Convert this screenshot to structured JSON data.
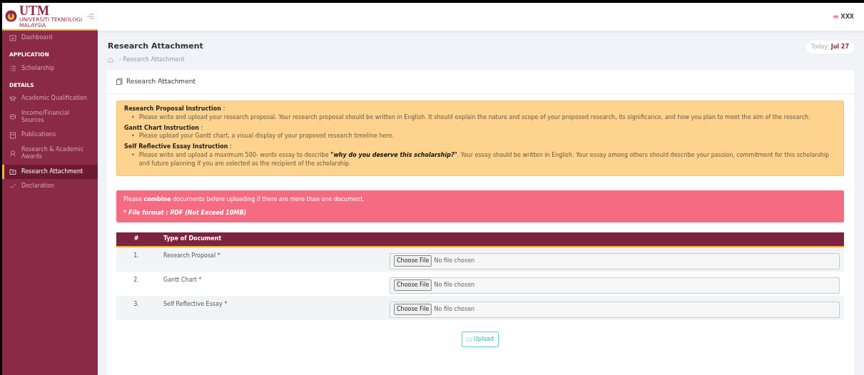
{
  "header": {
    "logo_text": "UTM",
    "logo_subtext": "UNIVERSITI TEKNOLOGI MALAYSIA",
    "user": "XXX"
  },
  "sidebar": {
    "items": [
      {
        "kind": "item",
        "label": "Dashboard",
        "selected": false
      },
      {
        "kind": "section",
        "label": "APPLICATION"
      },
      {
        "kind": "item",
        "label": "Scholarship",
        "selected": false
      },
      {
        "kind": "section",
        "label": "DETAILS"
      },
      {
        "kind": "item",
        "label": "Academic Qualification",
        "selected": false
      },
      {
        "kind": "item",
        "label": "Income/Financial Sources",
        "selected": false
      },
      {
        "kind": "item",
        "label": "Publications",
        "selected": false
      },
      {
        "kind": "item",
        "label": "Research & Academic Awards",
        "selected": false
      },
      {
        "kind": "item",
        "label": "Research Attachment",
        "selected": true
      },
      {
        "kind": "item",
        "label": "Declaration",
        "selected": false
      }
    ]
  },
  "page": {
    "title": "Research Attachment",
    "breadcrumb": "- Research Attachment",
    "today_label": "Today:",
    "today_date": "Jul 27"
  },
  "card": {
    "title": "Research Attachment",
    "instructions": [
      {
        "heading": "Research Proposal Instruction",
        "colon": ":",
        "bullets": [
          {
            "marker": "•",
            "text": "Please write and upload your research proposal. Your research proposal should be written in English. It should explain the nature and scope of your proposed research, its significance, and how you plan to meet the aim of the research."
          }
        ]
      },
      {
        "heading": "Gantt Chart Instruction",
        "colon": ":",
        "bullets": [
          {
            "marker": "•",
            "text": "Please upload your Gantt chart, a visual display of your proposed research timeline here."
          }
        ]
      },
      {
        "heading": "Self Reflective Essay Instruction",
        "colon": ":",
        "bullets": [
          {
            "marker": "•",
            "text": "Please write and upload a maximum 500- words essay to describe **\"why do you deserve this scholarship?\"**. Your essay should be written in English. Your essay among others should describe your passion, commitment for this scholarship and future planning if you are selected as the recipient of the scholarship."
          }
        ]
      }
    ],
    "notice": {
      "text": "Please **combine** documents before uploading if there are more than one document.",
      "format": "* File format : PDF (Not Exceed 10MB)"
    },
    "table": {
      "columns": [
        "#",
        "Type of Document"
      ],
      "rows": [
        {
          "number": "1.",
          "document": "Research Proposal *",
          "button": "Choose File",
          "status": "No file chosen"
        },
        {
          "number": "2.",
          "document": "Gantt Chart *",
          "button": "Choose File",
          "status": "No file chosen"
        },
        {
          "number": "3.",
          "document": "Self Reflective Essay *",
          "button": "Choose File",
          "status": "No file chosen"
        }
      ]
    },
    "upload_button": "Upload"
  }
}
